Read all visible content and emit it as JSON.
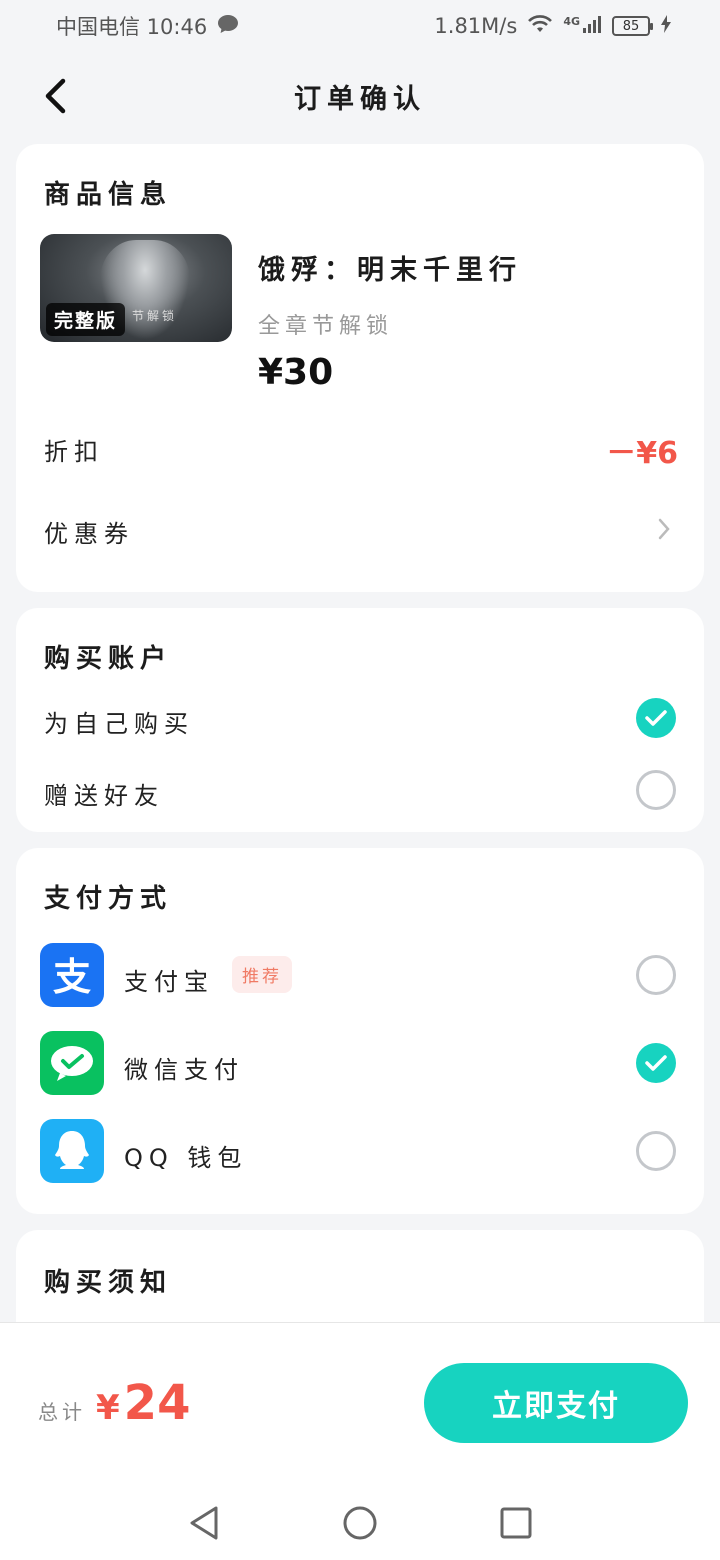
{
  "status": {
    "carrier_time": "中国电信 10:46",
    "speed": "1.81M/s",
    "network": "4G",
    "battery": "85"
  },
  "header": {
    "title": "订单确认"
  },
  "product": {
    "section_title": "商品信息",
    "cover_badge": "完整版",
    "cover_caption": "节解锁",
    "name": "饿殍：明末千里行",
    "desc": "全章节解锁",
    "price": "¥30",
    "discount_label": "折扣",
    "discount_value": "－¥6",
    "coupon_label": "优惠券"
  },
  "account": {
    "section_title": "购买账户",
    "options": [
      {
        "label": "为自己购买",
        "selected": true
      },
      {
        "label": "赠送好友",
        "selected": false
      }
    ]
  },
  "payment": {
    "section_title": "支付方式",
    "methods": [
      {
        "label": "支付宝",
        "tag": "推荐",
        "icon": "alipay-icon",
        "color": "#1a73f3",
        "selected": false
      },
      {
        "label": "微信支付",
        "icon": "wechat-pay-icon",
        "color": "#09c160",
        "selected": true
      },
      {
        "label": "QQ 钱包",
        "icon": "qq-wallet-icon",
        "color": "#1fb0f5",
        "selected": false
      }
    ]
  },
  "notice": {
    "section_title": "购买须知"
  },
  "footer": {
    "total_label": "总计",
    "currency": "¥",
    "total_value": "24",
    "pay_button": "立即支付"
  },
  "colors": {
    "accent": "#17d3c0",
    "price_red": "#f2574a"
  }
}
